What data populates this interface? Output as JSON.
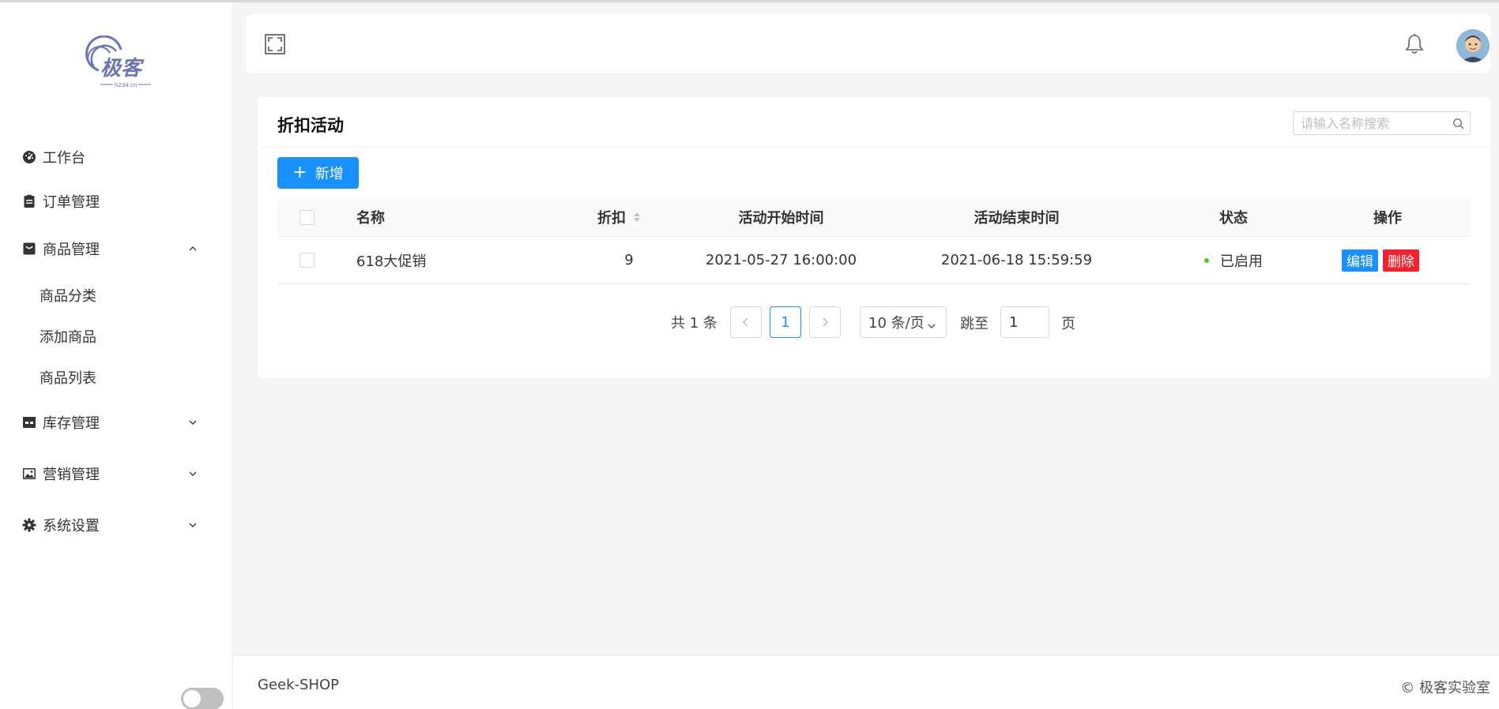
{
  "sidebar": {
    "logo": {
      "text": "极客",
      "subtext": "h234.cn",
      "color": "#6b74b8"
    },
    "items": [
      {
        "label": "工作台",
        "icon": "dashboard-icon"
      },
      {
        "label": "订单管理",
        "icon": "clipboard-icon"
      },
      {
        "label": "商品管理",
        "icon": "shop-bag-icon",
        "expanded": true,
        "children": [
          {
            "label": "商品分类"
          },
          {
            "label": "添加商品"
          },
          {
            "label": "商品列表"
          }
        ]
      },
      {
        "label": "库存管理",
        "icon": "inventory-icon",
        "expanded": false
      },
      {
        "label": "营销管理",
        "icon": "picture-icon",
        "expanded": false
      },
      {
        "label": "系统设置",
        "icon": "gear-icon",
        "expanded": false
      }
    ],
    "theme_toggle": {
      "on": false
    }
  },
  "header": {
    "fullscreen_icon": "fullscreen-icon",
    "bell_icon": "bell-icon",
    "avatar_icon": "user-avatar"
  },
  "page": {
    "title": "折扣活动",
    "search": {
      "placeholder": "请输入名称搜索",
      "value": ""
    },
    "add_button": "新增",
    "accent": "#1890ff"
  },
  "table": {
    "columns": [
      "名称",
      "折扣",
      "活动开始时间",
      "活动结束时间",
      "状态",
      "操作"
    ],
    "rows": [
      {
        "name": "618大促销",
        "discount": "9",
        "start": "2021-05-27 16:00:00",
        "end": "2021-06-18 15:59:59",
        "status": "已启用",
        "status_color": "#52c41a",
        "actions": {
          "edit": "编辑",
          "delete": "删除"
        }
      }
    ]
  },
  "pagination": {
    "total": "共 1 条",
    "current": "1",
    "prev_icon": "chevron-left-icon",
    "next_icon": "chevron-right-icon",
    "page_size": "10 条/页",
    "jump_label": "跳至",
    "jump_value": "1",
    "page_label": "页"
  },
  "footer": {
    "left": "Geek-SHOP",
    "right": "© 极客实验室"
  }
}
